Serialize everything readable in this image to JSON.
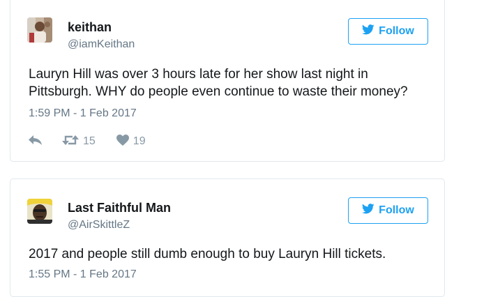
{
  "tweets": [
    {
      "name": "keithan",
      "handle": "@iamKeithan",
      "follow_label": "Follow",
      "text": "Lauryn Hill was over 3 hours late for her show last night in\nPittsburgh. WHY do people even continue to waste their money?",
      "timestamp": "1:59 PM - 1 Feb 2017",
      "retweets": "15",
      "likes": "19",
      "avatar_icon": "profile-photo"
    },
    {
      "name": "Last Faithful Man",
      "handle": "@AirSkittleZ",
      "follow_label": "Follow",
      "text": "2017 and people still dumb enough to buy Lauryn Hill tickets.",
      "timestamp": "1:55 PM - 1 Feb 2017",
      "avatar_icon": "profile-photo"
    }
  ],
  "colors": {
    "accent": "#1da1f2",
    "text": "#14171a",
    "muted": "#657786",
    "icon": "#8899a6",
    "border": "#e1e8ed"
  },
  "icons": {
    "follow": "bird-icon",
    "reply": "reply-icon",
    "retweet": "retweet-icon",
    "like": "heart-icon"
  }
}
